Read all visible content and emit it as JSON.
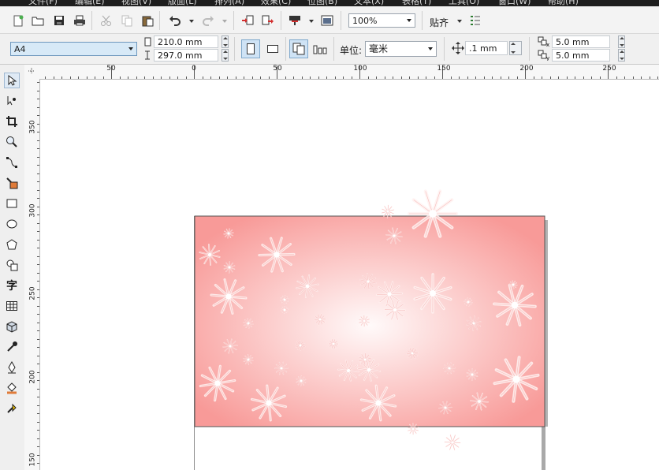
{
  "menu": [
    "文件(F)",
    "编辑(E)",
    "视图(V)",
    "版面(L)",
    "排列(A)",
    "效果(C)",
    "位图(B)",
    "文本(X)",
    "表格(T)",
    "工具(O)",
    "窗口(W)",
    "帮助(H)"
  ],
  "toolbar": {
    "zoom": "100%",
    "snap_label": "贴齐"
  },
  "property_bar": {
    "page_size": "A4",
    "width": "210.0 mm",
    "height": "297.0 mm",
    "units_label": "单位:",
    "units_value": "毫米",
    "nudge": ".1 mm",
    "dup_x": "5.0 mm",
    "dup_y": "5.0 mm"
  },
  "ruler": {
    "h_labels": [
      "50",
      "0",
      "50",
      "100",
      "150",
      "200",
      "250"
    ],
    "v_labels": [
      "350",
      "300",
      "250",
      "200",
      "150"
    ]
  },
  "toolbox": [
    "pick-tool",
    "shape-tool",
    "crop-tool",
    "zoom-tool",
    "freehand-tool",
    "smart-fill-tool",
    "rectangle-tool",
    "ellipse-tool",
    "polygon-tool",
    "basic-shapes-tool",
    "text-tool",
    "table-tool",
    "extrude-tool",
    "eyedropper-tool",
    "outline-tool",
    "fill-tool",
    "interactive-fill-tool"
  ],
  "text_tool_glyph": "字",
  "colors": {
    "gradient_center": "#fffafa",
    "gradient_edge": "#f89a98",
    "menubar": "#1e1e1e",
    "combo_highlight": "#d7e9f7"
  }
}
